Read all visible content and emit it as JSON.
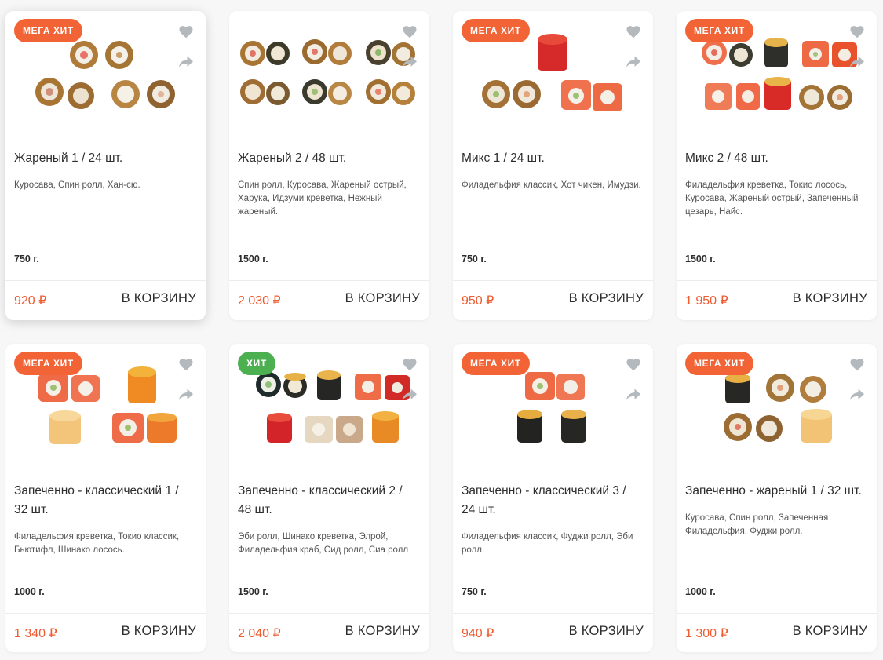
{
  "colors": {
    "accent": "#ef5a2f",
    "badge_mega": "#f26336",
    "badge_hit": "#4caf50",
    "icon_gray": "#b3b9bd"
  },
  "cart_label": "В КОРЗИНУ",
  "products": [
    {
      "badge": "МЕГА ХИТ",
      "title": "Жареный 1 / 24 шт.",
      "description": "Куросава, Спин ролл, Хан-сю.",
      "weight": "750 г.",
      "price": "920 ₽"
    },
    {
      "badge": "",
      "title": "Жареный 2 / 48 шт.",
      "description": "Спин ролл, Куросава, Жареный острый, Харука, Идзуми креветка, Нежный жареный.",
      "weight": "1500 г.",
      "price": "2 030 ₽"
    },
    {
      "badge": "МЕГА ХИТ",
      "title": "Микс 1 / 24 шт.",
      "description": "Филадельфия классик, Хот чикен, Имудзи.",
      "weight": "750 г.",
      "price": "950 ₽"
    },
    {
      "badge": "МЕГА ХИТ",
      "title": "Микс 2 / 48 шт.",
      "description": "Филадельфия креветка, Токио лосось, Куросава, Жареный острый, Запеченный цезарь, Найс.",
      "weight": "1500 г.",
      "price": "1 950 ₽"
    },
    {
      "badge": "МЕГА ХИТ",
      "title": "Запеченно - классический 1 / 32 шт.",
      "description": "Филадельфия креветка, Токио классик, Бьютифл, Шинако лосось.",
      "weight": "1000 г.",
      "price": "1 340 ₽"
    },
    {
      "badge": "ХИТ",
      "title": "Запеченно - классический 2 / 48 шт.",
      "description": "Эби ролл, Шинако креветка, Элрой, Филадельфия краб, Сид ролл, Сиа ролл",
      "weight": "1500 г.",
      "price": "2 040 ₽"
    },
    {
      "badge": "МЕГА ХИТ",
      "title": "Запеченно - классический 3 / 24 шт.",
      "description": "Филадельфия классик, Фуджи ролл, Эби ролл.",
      "weight": "750 г.",
      "price": "940 ₽"
    },
    {
      "badge": "МЕГА ХИТ",
      "title": "Запеченно - жареный 1 / 32 шт.",
      "description": "Куросава, Спин ролл, Запеченная Филадельфия, Фуджи ролл.",
      "weight": "1000 г.",
      "price": "1 300 ₽"
    }
  ]
}
